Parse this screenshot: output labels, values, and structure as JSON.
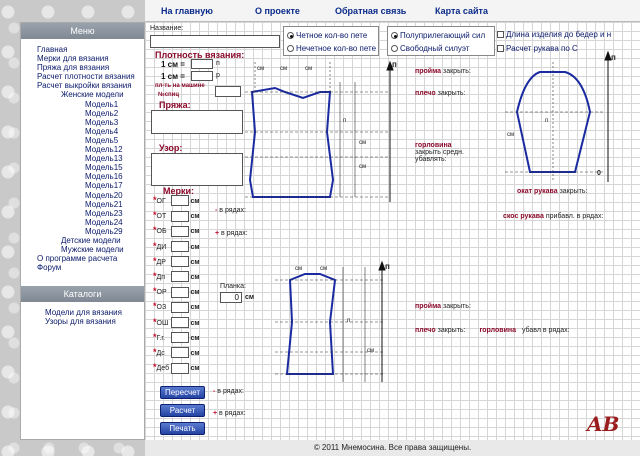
{
  "nav": {
    "home": "На главную",
    "about": "О проекте",
    "feedback": "Обратная связь",
    "sitemap": "Карта сайта"
  },
  "sidebar": {
    "menu_title": "Меню",
    "items": [
      "Главная",
      "Мерки для вязания",
      "Пряжа для вязания",
      "Расчет плотности вязания",
      "Расчет выкройки вязания",
      "Женские модели",
      "Модель1",
      "Модель2",
      "Модель3",
      "Модель4",
      "Модель5",
      "Модель12",
      "Модель13",
      "Модель15",
      "Модель16",
      "Модель17",
      "Модель20",
      "Модель21",
      "Модель23",
      "Модель24",
      "Модель29",
      "Детские модели",
      "Мужские модели",
      "О программе расчета",
      "Форум"
    ],
    "catalog_title": "Каталоги",
    "catalog_items": [
      "Модели для вязания",
      "Узоры для вязания"
    ]
  },
  "form": {
    "name_label": "Название:",
    "density_title": "Плотность вязания:",
    "one_cm": "1 см =",
    "p_unit": "п",
    "r_unit": "р",
    "machine_label": "пл-ть на машине",
    "nsp_label": "№спиц",
    "yarn_title": "Пряжа:",
    "pattern_title": "Узор:",
    "measures_title": "Мерки:",
    "measure_codes": [
      "ОГ",
      "ОТ",
      "ОБ",
      "ДИ",
      "ДР",
      "Дп",
      "ОР",
      "ОЗ",
      "ОШ",
      "Г.г.",
      "Дс",
      "Деб"
    ],
    "cm": "см",
    "in_rows": "в рядах:",
    "placket_label": "Планка:",
    "placket_value": "0",
    "radio1": [
      "Четное кол-во пете",
      "Нечетное кол-во пете"
    ],
    "radio2": [
      "Полуприлегающий сил",
      "Свободный силуэт"
    ],
    "checks": [
      "Длина изделия до бедер и н",
      "Расчет рукава по С"
    ],
    "buttons": {
      "recalc": "Пересчет",
      "calc": "Расчет",
      "print": "Печать"
    }
  },
  "diagram": {
    "labels": {
      "armhole": "пройма",
      "close": "закрыть:",
      "shoulder": "плечо",
      "neck": "горловина",
      "close_mid": "закрыть средн.",
      "decrease": "убавлять:",
      "sleeve_cap": "окат рукава",
      "sleeve_bevel": "скос рукава",
      "add_in_rows": "прибавл. в рядах:",
      "dec_in_rows": "убавл в рядах:",
      "cm": "см",
      "p": "п",
      "r": "р",
      "zero": "0"
    }
  },
  "footer": "© 2011 Мнемосина. Все права защищены.",
  "logo": "AB"
}
